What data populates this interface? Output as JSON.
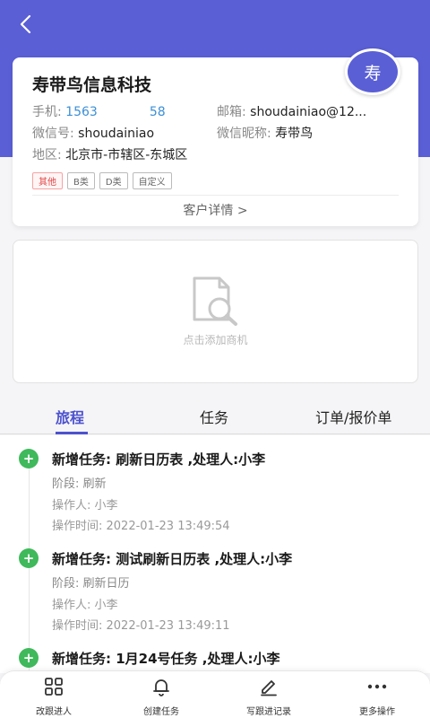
{
  "header": {
    "back_icon": "chevron-left-icon",
    "bg_color": "#5a5fd6"
  },
  "customer": {
    "company_name": "寿带鸟信息科技",
    "avatar_text": "寿",
    "phone_label": "手机:",
    "phone_value": "1563",
    "phone_value_end": "58",
    "email_label": "邮箱:",
    "email_value": "shoudainiao@12...",
    "wechat_id_label": "微信号:",
    "wechat_id_value": "shoudainiao",
    "wechat_nick_label": "微信昵称:",
    "wechat_nick_value": "寿带鸟",
    "region_label": "地区:",
    "region_value": "北京市-市辖区-东城区",
    "tags": [
      "其他",
      "B类",
      "D类",
      "自定义"
    ],
    "detail_link": "客户详情",
    "detail_chevron": ">"
  },
  "opportunity": {
    "icon": "document-search-icon",
    "text": "点击添加商机"
  },
  "tabs": [
    {
      "label": "旅程",
      "active": true
    },
    {
      "label": "任务",
      "active": false
    },
    {
      "label": "订单/报价单",
      "active": false
    }
  ],
  "timeline": [
    {
      "icon": "+",
      "title": "新增任务: 刷新日历表 ,处理人:小李",
      "stage": "阶段: 刷新",
      "operator": "操作人: 小李",
      "time": "操作时间: 2022-01-23 13:49:54"
    },
    {
      "icon": "+",
      "title": "新增任务: 测试刷新日历表 ,处理人:小李",
      "stage": "阶段: 刷新日历",
      "operator": "操作人: 小李",
      "time": "操作时间: 2022-01-23 13:49:11"
    },
    {
      "icon": "+",
      "title": "新增任务: 1月24号任务 ,处理人:小李"
    }
  ],
  "bottom_nav": [
    {
      "icon": "grid-icon",
      "label": "改跟进人"
    },
    {
      "icon": "bell-icon",
      "label": "创建任务"
    },
    {
      "icon": "pencil-icon",
      "label": "写跟进记录"
    },
    {
      "icon": "more-dots-icon",
      "label": "更多操作"
    }
  ]
}
